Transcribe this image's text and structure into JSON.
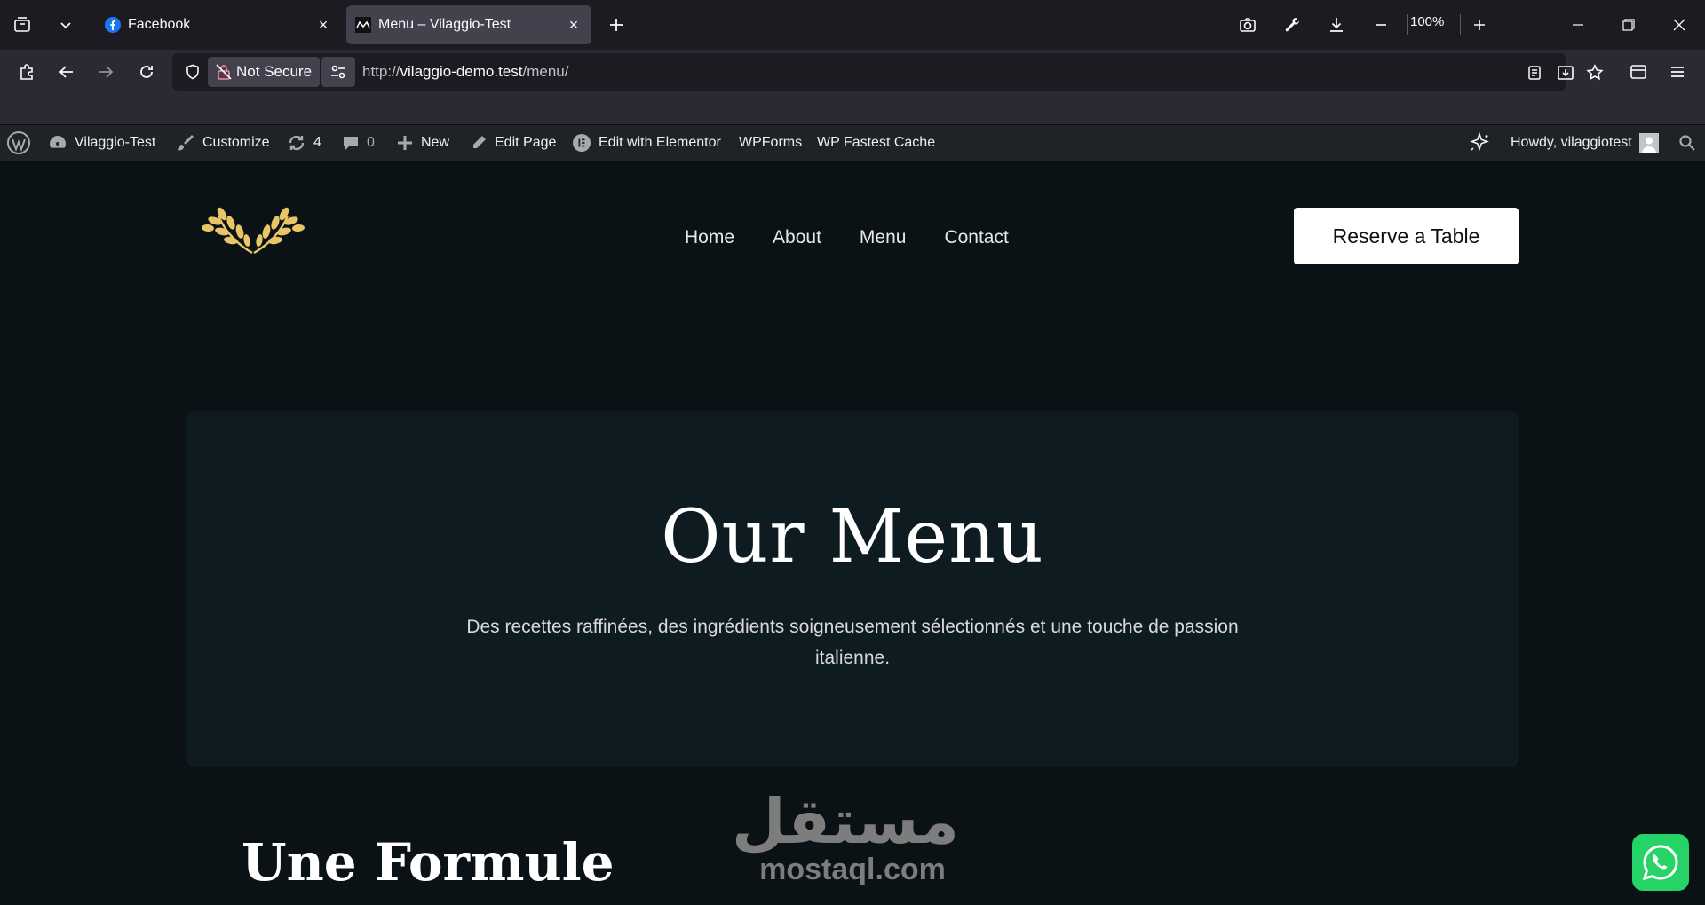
{
  "browser": {
    "tabs": [
      {
        "title": "Facebook",
        "icon": "facebook-icon",
        "active": false
      },
      {
        "title": "Menu – Vilaggio-Test",
        "icon": "site-icon",
        "active": true
      }
    ],
    "zoom": "100%",
    "security_label": "Not Secure",
    "url_scheme": "http://",
    "url_host": "vilaggio-demo.test",
    "url_path": "/menu/"
  },
  "wp_admin_bar": {
    "site_name": "Vilaggio-Test",
    "customize": "Customize",
    "updates_count": "4",
    "comments_count": "0",
    "new": "New",
    "edit_page": "Edit Page",
    "edit_with_elementor": "Edit with Elementor",
    "wpforms": "WPForms",
    "wp_fastest_cache": "WP Fastest Cache",
    "howdy": "Howdy, vilaggiotest"
  },
  "site": {
    "nav": [
      "Home",
      "About",
      "Menu",
      "Contact"
    ],
    "cta": "Reserve a Table",
    "hero_title": "Our Menu",
    "hero_subtitle": "Des recettes raffinées, des ingrédients soigneusement sélectionnés et une touche de passion italienne.",
    "section_title": "Une Formule",
    "accent_color": "#e8c566"
  },
  "watermark": {
    "arabic": "مستقل",
    "latin": "mostaql.com"
  }
}
